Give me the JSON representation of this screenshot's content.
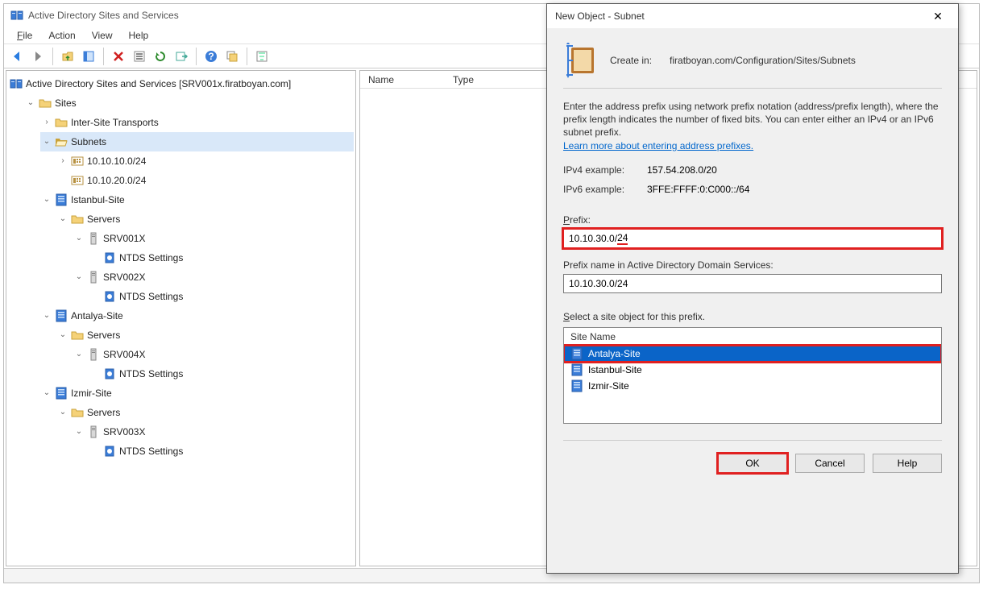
{
  "window": {
    "title": "Active Directory Sites and Services",
    "menu": {
      "file": "File",
      "action": "Action",
      "view": "View",
      "help": "Help"
    },
    "list_cols": {
      "name": "Name",
      "type": "Type"
    }
  },
  "tree": {
    "root": "Active Directory Sites and Services [SRV001x.firatboyan.com]",
    "sites": "Sites",
    "inter": "Inter-Site Transports",
    "subnets": "Subnets",
    "subnet1": "10.10.10.0/24",
    "subnet2": "10.10.20.0/24",
    "site_ist": "Istanbul-Site",
    "servers": "Servers",
    "srv1": "SRV001X",
    "srv2": "SRV002X",
    "srv3": "SRV003X",
    "srv4": "SRV004X",
    "ntds": "NTDS Settings",
    "site_ant": "Antalya-Site",
    "site_izm": "Izmir-Site"
  },
  "dialog": {
    "title": "New Object - Subnet",
    "create_in_label": "Create in:",
    "create_in_path": "firatboyan.com/Configuration/Sites/Subnets",
    "instr1": "Enter the address prefix using network prefix notation (address/prefix length), where the prefix length indicates the number of fixed bits. You can enter either an IPv4 or an IPv6 subnet prefix.",
    "link": "Learn more about entering address prefixes.",
    "ipv4_label": "IPv4 example:",
    "ipv4_value": "157.54.208.0/20",
    "ipv6_label": "IPv6 example:",
    "ipv6_value": "3FFE:FFFF:0:C000::/64",
    "prefix_label": "Prefix:",
    "prefix_value_a": "10.10.30.0/",
    "prefix_value_b": "24",
    "prefixname_label": "Prefix name in Active Directory Domain Services:",
    "prefixname_value": "10.10.30.0/24",
    "select_label": "Select a site object for this prefix.",
    "col_sitename": "Site Name",
    "site1": "Antalya-Site",
    "site2": "Istanbul-Site",
    "site3": "Izmir-Site",
    "ok": "OK",
    "cancel": "Cancel",
    "help": "Help"
  }
}
